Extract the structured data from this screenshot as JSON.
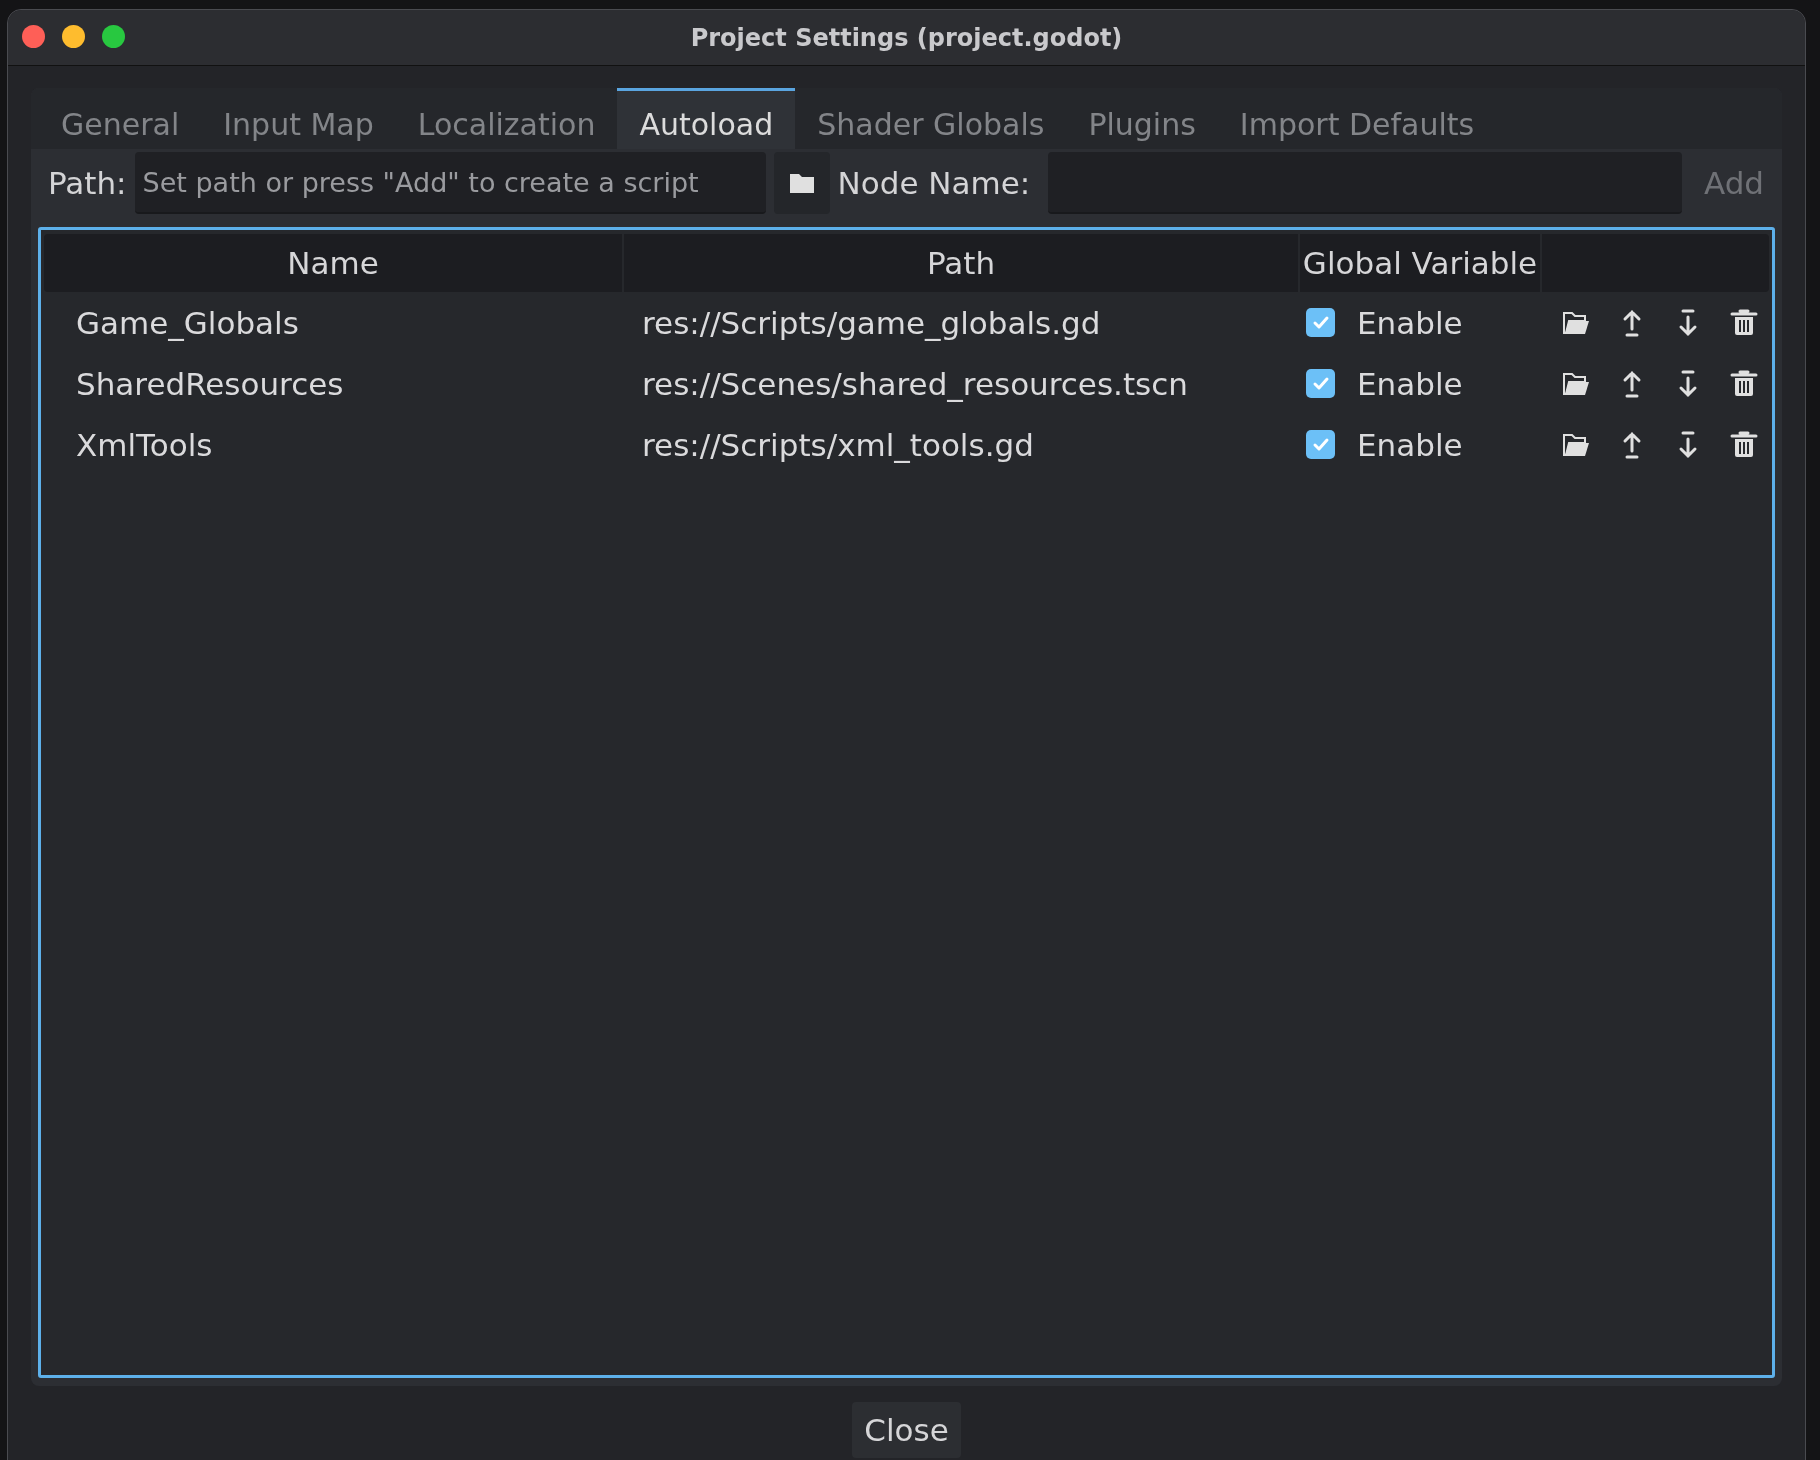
{
  "window": {
    "title": "Project Settings (project.godot)"
  },
  "tabs": [
    {
      "label": "General",
      "selected": false
    },
    {
      "label": "Input Map",
      "selected": false
    },
    {
      "label": "Localization",
      "selected": false
    },
    {
      "label": "Autoload",
      "selected": true
    },
    {
      "label": "Shader Globals",
      "selected": false
    },
    {
      "label": "Plugins",
      "selected": false
    },
    {
      "label": "Import Defaults",
      "selected": false
    }
  ],
  "path_bar": {
    "path_label": "Path:",
    "path_placeholder": "Set path or press \"Add\" to create a script",
    "node_name_label": "Node Name:",
    "add_button": {
      "label": "Add",
      "disabled": true
    }
  },
  "table": {
    "columns": [
      "Name",
      "Path",
      "Global Variable"
    ],
    "rows": [
      {
        "name": "Game_Globals",
        "path": "res://Scripts/game_globals.gd",
        "enable_label": "Enable",
        "checked": true
      },
      {
        "name": "SharedResources",
        "path": "res://Scenes/shared_resources.tscn",
        "enable_label": "Enable",
        "checked": true
      },
      {
        "name": "XmlTools",
        "path": "res://Scripts/xml_tools.gd",
        "enable_label": "Enable",
        "checked": true
      }
    ]
  },
  "buttons": [
    {
      "label": "Close"
    }
  ]
}
